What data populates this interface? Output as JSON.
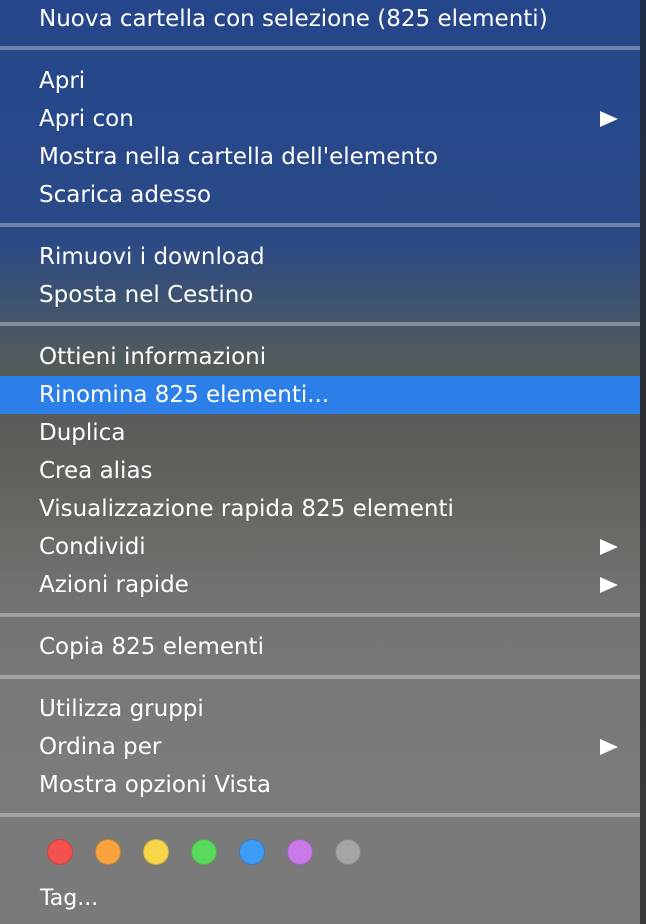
{
  "menu": {
    "header": "Nuova cartella con selezione (825 elementi)",
    "items": [
      {
        "label": "Apri"
      },
      {
        "label": "Apri con",
        "submenu": true
      },
      {
        "label": "Mostra nella cartella dell'elemento"
      },
      {
        "label": "Scarica adesso"
      },
      {
        "label": "Rimuovi i download"
      },
      {
        "label": "Sposta nel Cestino"
      },
      {
        "label": "Ottieni informazioni"
      },
      {
        "label": "Rinomina 825 elementi...",
        "highlighted": true
      },
      {
        "label": "Duplica"
      },
      {
        "label": "Crea alias"
      },
      {
        "label": "Visualizzazione rapida 825 elementi"
      },
      {
        "label": "Condividi",
        "submenu": true
      },
      {
        "label": "Azioni rapide",
        "submenu": true
      },
      {
        "label": "Copia 825 elementi"
      },
      {
        "label": "Utilizza gruppi"
      },
      {
        "label": "Ordina per",
        "submenu": true
      },
      {
        "label": "Mostra opzioni Vista"
      }
    ],
    "tags_label": "Tag...",
    "tag_colors": [
      {
        "name": "red",
        "color": "#f2524e"
      },
      {
        "name": "orange",
        "color": "#f7a23c"
      },
      {
        "name": "yellow",
        "color": "#f7d74a"
      },
      {
        "name": "green",
        "color": "#5ad95e"
      },
      {
        "name": "blue",
        "color": "#3d9bf5"
      },
      {
        "name": "purple",
        "color": "#c87ae8"
      },
      {
        "name": "gray",
        "color": "#a5a5a8"
      }
    ],
    "submenu_icon": "triangle-right-icon",
    "highlight_color": "#2c7fe8"
  }
}
